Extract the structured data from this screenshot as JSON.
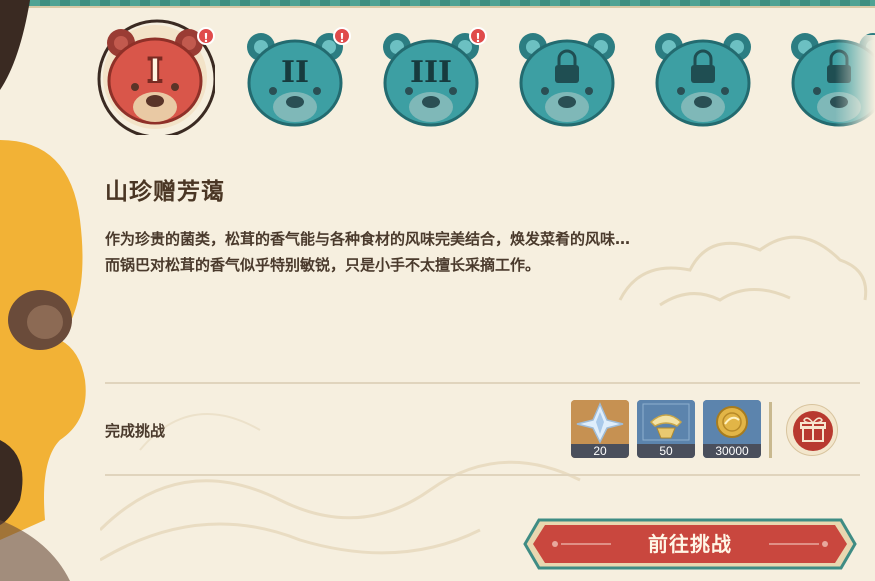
{
  "tiers": [
    {
      "numeral": "I",
      "state": "selected",
      "alert": "!"
    },
    {
      "numeral": "II",
      "state": "unlocked",
      "alert": "!"
    },
    {
      "numeral": "III",
      "state": "unlocked",
      "alert": "!"
    },
    {
      "numeral": "",
      "state": "locked",
      "alert": ""
    },
    {
      "numeral": "",
      "state": "locked",
      "alert": ""
    },
    {
      "numeral": "",
      "state": "locked",
      "alert": ""
    }
  ],
  "challenge": {
    "title": "山珍赠芳蔼",
    "description_line1": "作为珍贵的菌类，松茸的香气能与各种食材的风味完美结合，焕发菜肴的风味…",
    "description_line2": "而锅巴对松茸的香气似乎特别敏锐，只是小手不太擅长采摘工作。",
    "complete_label": "完成挑战"
  },
  "rewards": [
    {
      "icon": "primogem-icon",
      "count": "20"
    },
    {
      "icon": "hero-wit-icon",
      "count": "50"
    },
    {
      "icon": "mora-icon",
      "count": "30000"
    }
  ],
  "go_button": {
    "label": "前往挑战"
  },
  "colors": {
    "selected_bear": "#d9564a",
    "unlocked_bear": "#3d9fa3",
    "button_red": "#c9473e",
    "background": "#f6efdf"
  }
}
